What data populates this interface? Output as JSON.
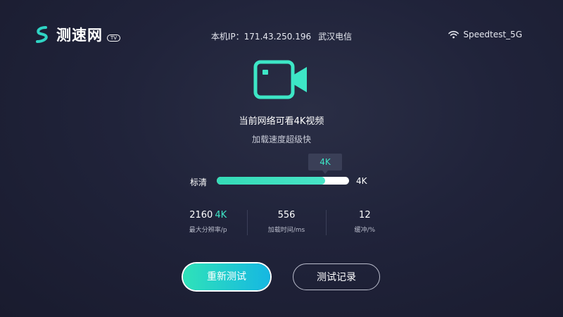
{
  "header": {
    "logo_text": "测速网",
    "logo_badge": "TV",
    "ip_label": "本机IP：171.43.250.196",
    "isp": "武汉电信",
    "wifi_name": "Speedtest_5G",
    "wifi_icon": "wifi-icon",
    "logo_icon": "s-logo-icon"
  },
  "result": {
    "icon": "video-camera-icon",
    "title": "当前网络可看4K视频",
    "subtitle": "加载速度超级快"
  },
  "quality_bar": {
    "min_label": "标清",
    "max_label": "4K",
    "tooltip": "4K",
    "level_fraction": 0.82
  },
  "stats": [
    {
      "value": "2160",
      "accent": "4K",
      "label": "最大分辨率/p"
    },
    {
      "value": "556",
      "accent": "",
      "label": "加载时间/ms"
    },
    {
      "value": "12",
      "accent": "",
      "label": "缓冲/%"
    }
  ],
  "buttons": {
    "retest": "重新测试",
    "history": "测试记录"
  },
  "colors": {
    "accent": "#3de6c6",
    "background": "#20233a",
    "button_gradient_start": "#2fe2b9",
    "button_gradient_end": "#16b7e2"
  }
}
